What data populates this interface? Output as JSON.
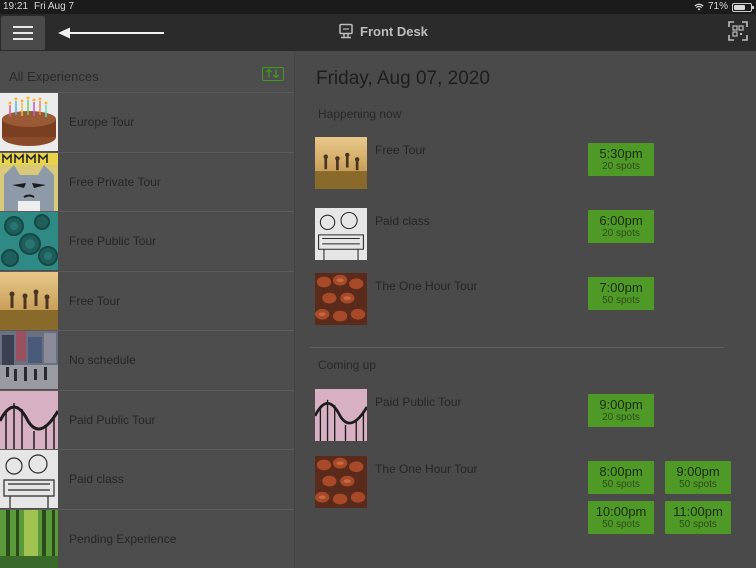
{
  "status_bar": {
    "time": "19:21",
    "date": "Fri Aug 7",
    "battery": "71%",
    "battery_level": 0.71
  },
  "navbar": {
    "title": "Front Desk",
    "menu_icon": "hamburger-menu-icon",
    "arrow_icon": "left-arrow-icon",
    "scan_icon": "qr-scan-icon"
  },
  "sidebar": {
    "title": "All Experiences",
    "sort_icon": "sort-arrows-icon",
    "items": [
      {
        "label": "Europe Tour",
        "thumb": "cake"
      },
      {
        "label": "Free Private Tour",
        "thumb": "cat-meme"
      },
      {
        "label": "Free Public Tour",
        "thumb": "virus"
      },
      {
        "label": "Free Tour",
        "thumb": "field-people"
      },
      {
        "label": "No schedule",
        "thumb": "city-street"
      },
      {
        "label": "Paid Public Tour",
        "thumb": "rollercoaster"
      },
      {
        "label": "Paid class",
        "thumb": "sketch"
      },
      {
        "label": "Pending Experience",
        "thumb": "forest"
      }
    ]
  },
  "main": {
    "date": "Friday, Aug 07, 2020",
    "happening_now": {
      "label": "Happening now",
      "tours": [
        {
          "name": "Free Tour",
          "thumb": "field-people",
          "slots": [
            {
              "time": "5:30pm",
              "spots": "20 spots"
            }
          ]
        },
        {
          "name": "Paid class",
          "thumb": "sketch",
          "slots": [
            {
              "time": "6:00pm",
              "spots": "20 spots"
            }
          ]
        },
        {
          "name": "The One Hour Tour",
          "thumb": "eggs",
          "slots": [
            {
              "time": "7:00pm",
              "spots": "50 spots"
            }
          ]
        }
      ]
    },
    "coming_up": {
      "label": "Coming up",
      "tours": [
        {
          "name": "Paid Public Tour",
          "thumb": "rollercoaster",
          "slots": [
            {
              "time": "9:00pm",
              "spots": "20 spots"
            }
          ]
        },
        {
          "name": "The One Hour Tour",
          "thumb": "eggs",
          "slots": [
            {
              "time": "8:00pm",
              "spots": "50 spots"
            },
            {
              "time": "9:00pm",
              "spots": "50 spots"
            },
            {
              "time": "10:00pm",
              "spots": "50 spots"
            },
            {
              "time": "11:00pm",
              "spots": "50 spots"
            }
          ]
        }
      ]
    }
  },
  "colors": {
    "accent_green": "#4f9a26",
    "navbar": "#2b2b2b",
    "overlay_bg": "#4a4a4a"
  }
}
